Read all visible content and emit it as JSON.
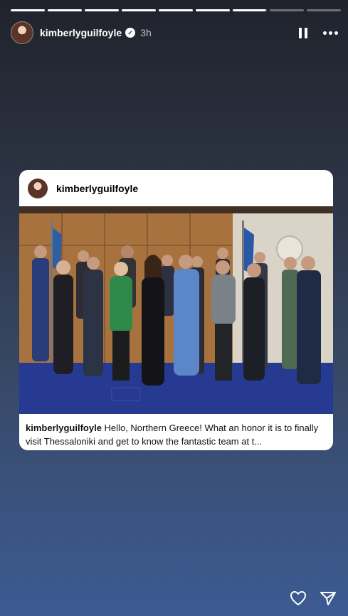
{
  "story": {
    "segments_total": 9,
    "segments_complete": 6,
    "current_segment_progress": 0.95
  },
  "header": {
    "username": "kimberlyguilfoyle",
    "timestamp": "3h",
    "verified_icon": "verified-badge-icon",
    "pause_icon": "pause-icon",
    "more_icon": "more-options-icon"
  },
  "shared_post": {
    "username": "kimberlyguilfoyle",
    "caption_user": "kimberlyguilfoyle",
    "caption_text": "Hello, Northern Greece! What an honor it is to finally visit Thessaloniki and get to know the fantastic team at t..."
  },
  "footer": {
    "like_icon": "heart-icon",
    "share_icon": "send-icon"
  },
  "colors": {
    "bg_top": "#20232c",
    "bg_bottom": "#3c5b93",
    "card_bg": "#ffffff"
  }
}
